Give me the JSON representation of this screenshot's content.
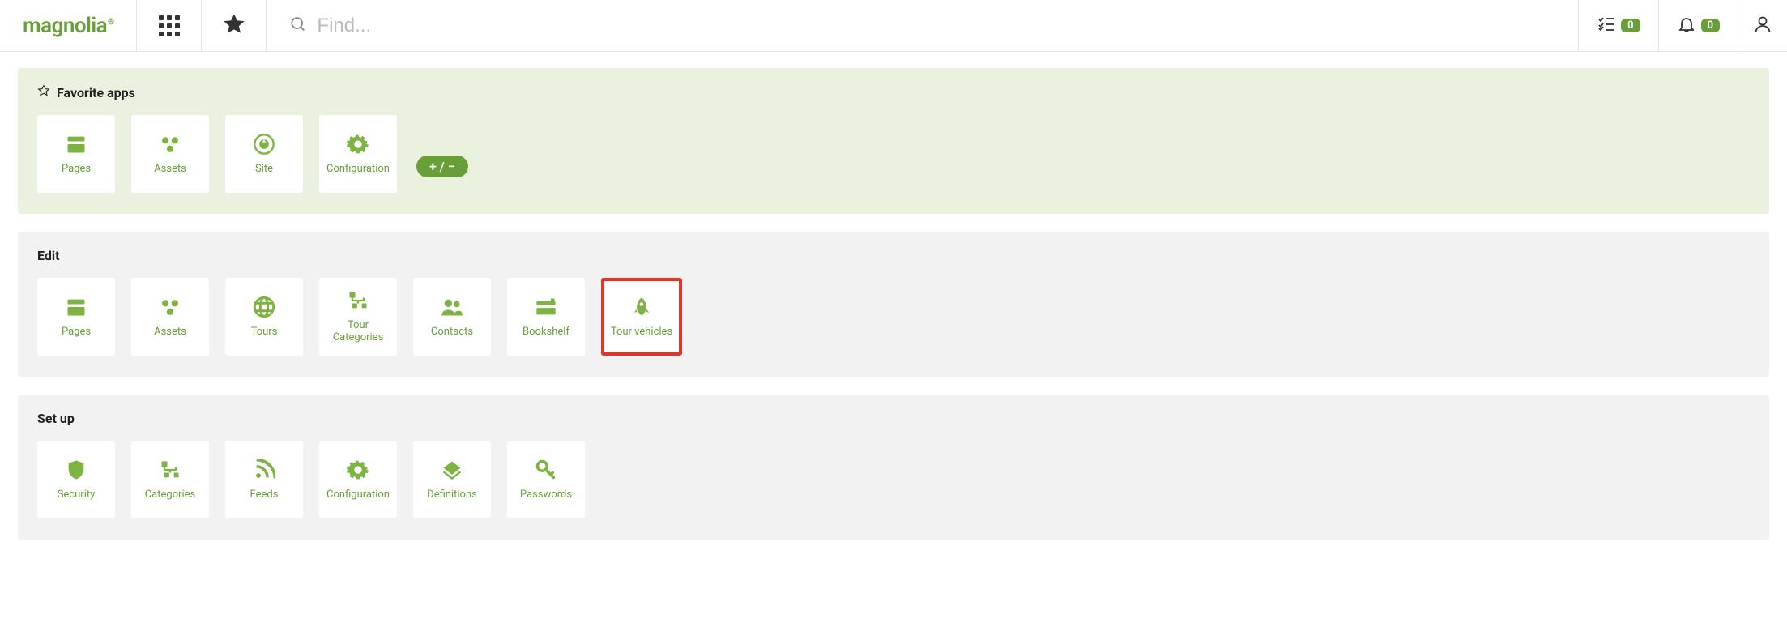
{
  "header": {
    "logo": "magnolia",
    "search_placeholder": "Find...",
    "tasks_count": "0",
    "notifications_count": "0"
  },
  "sections": {
    "favorites": {
      "title": "Favorite apps",
      "plusminus": "+ / −",
      "tiles": [
        {
          "id": "pages",
          "label": "Pages",
          "icon": "pages-icon"
        },
        {
          "id": "assets",
          "label": "Assets",
          "icon": "assets-icon"
        },
        {
          "id": "site",
          "label": "Site",
          "icon": "site-icon"
        },
        {
          "id": "configuration",
          "label": "Configuration",
          "icon": "gear-icon"
        }
      ]
    },
    "edit": {
      "title": "Edit",
      "tiles": [
        {
          "id": "pages",
          "label": "Pages",
          "icon": "pages-icon"
        },
        {
          "id": "assets",
          "label": "Assets",
          "icon": "assets-icon"
        },
        {
          "id": "tours",
          "label": "Tours",
          "icon": "globe-icon"
        },
        {
          "id": "tour-categories",
          "label": "Tour Categories",
          "icon": "categories-icon"
        },
        {
          "id": "contacts",
          "label": "Contacts",
          "icon": "contacts-icon"
        },
        {
          "id": "bookshelf",
          "label": "Bookshelf",
          "icon": "bookshelf-icon"
        },
        {
          "id": "tour-vehicles",
          "label": "Tour vehicles",
          "icon": "rocket-icon",
          "highlight": true
        }
      ]
    },
    "setup": {
      "title": "Set up",
      "tiles": [
        {
          "id": "security",
          "label": "Security",
          "icon": "shield-icon"
        },
        {
          "id": "categories",
          "label": "Categories",
          "icon": "categories-icon"
        },
        {
          "id": "feeds",
          "label": "Feeds",
          "icon": "rss-icon"
        },
        {
          "id": "configuration",
          "label": "Configuration",
          "icon": "gear-icon"
        },
        {
          "id": "definitions",
          "label": "Definitions",
          "icon": "definitions-icon"
        },
        {
          "id": "passwords",
          "label": "Passwords",
          "icon": "key-icon"
        }
      ]
    }
  }
}
